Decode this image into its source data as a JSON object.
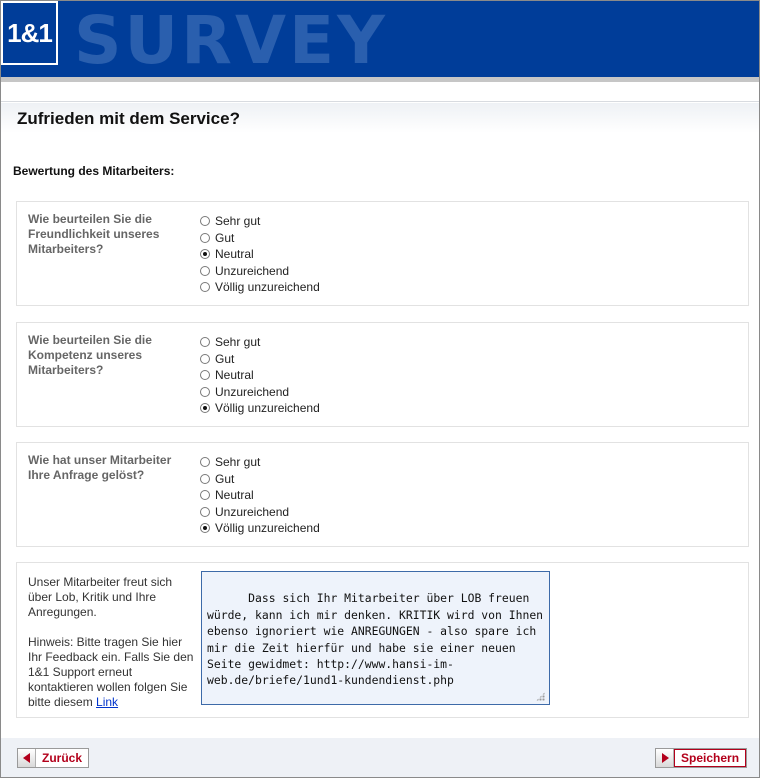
{
  "brand": {
    "logo_text": "1&1",
    "header_word": "SURVEY",
    "primary_color": "#003d99",
    "accent_color": "#b3001b"
  },
  "page": {
    "title": "Zufrieden mit dem Service?",
    "section_heading": "Bewertung des Mitarbeiters:"
  },
  "questions": [
    {
      "label": "Wie beurteilen Sie die Freundlichkeit unseres Mitarbeiters?",
      "options": [
        "Sehr gut",
        "Gut",
        "Neutral",
        "Unzureichend",
        "Völlig unzureichend"
      ],
      "selected": "Neutral"
    },
    {
      "label": "Wie beurteilen Sie die Kompetenz unseres Mitarbeiters?",
      "options": [
        "Sehr gut",
        "Gut",
        "Neutral",
        "Unzureichend",
        "Völlig unzureichend"
      ],
      "selected": "Völlig unzureichend"
    },
    {
      "label": "Wie hat unser Mitarbeiter Ihre Anfrage gelöst?",
      "options": [
        "Sehr gut",
        "Gut",
        "Neutral",
        "Unzureichend",
        "Völlig unzureichend"
      ],
      "selected": "Völlig unzureichend"
    }
  ],
  "feedback": {
    "intro": "Unser Mitarbeiter freut sich über Lob, Kritik und Ihre Anregungen.",
    "hint": "Hinweis: Bitte tragen Sie hier Ihr Feedback ein. Falls Sie den 1&1 Support erneut kontaktieren wollen folgen Sie bitte diesem",
    "link_text": "Link",
    "text_value": "Dass sich Ihr Mitarbeiter über LOB freuen würde, kann ich mir denken. KRITIK wird von Ihnen ebenso ignoriert wie ANREGUNGEN - also spare ich mir die Zeit hierfür und habe sie einer neuen Seite gewidmet: http://www.hansi-im-web.de/briefe/1und1-kundendienst.php"
  },
  "footer": {
    "back_label": "Zurück",
    "save_label": "Speichern",
    "back_icon": "arrow-left-icon",
    "save_icon": "arrow-right-icon"
  }
}
